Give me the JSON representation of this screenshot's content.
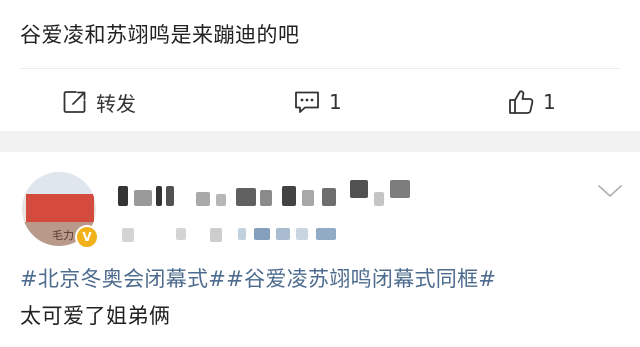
{
  "post1": {
    "text": "谷爱凌和苏翊鸣是来蹦迪的吧",
    "actions": {
      "repost_label": "转发",
      "comment_count": "1",
      "like_count": "1"
    }
  },
  "post2": {
    "avatar_text": "毛力 啊",
    "verified_badge": "V",
    "hashtags": [
      "#北京冬奥会闭幕式#",
      "#谷爱凌苏翊鸣闭幕式同框#"
    ],
    "text": "太可爱了姐弟俩"
  },
  "colors": {
    "link": "#4d6b8e",
    "text": "#222222",
    "separator": "#f2f2f2",
    "badge": "#f2b31a"
  },
  "icons": {
    "repost": "edit-share-icon",
    "comment": "comment-icon",
    "like": "thumbs-up-icon",
    "menu": "chevron-down-icon"
  }
}
